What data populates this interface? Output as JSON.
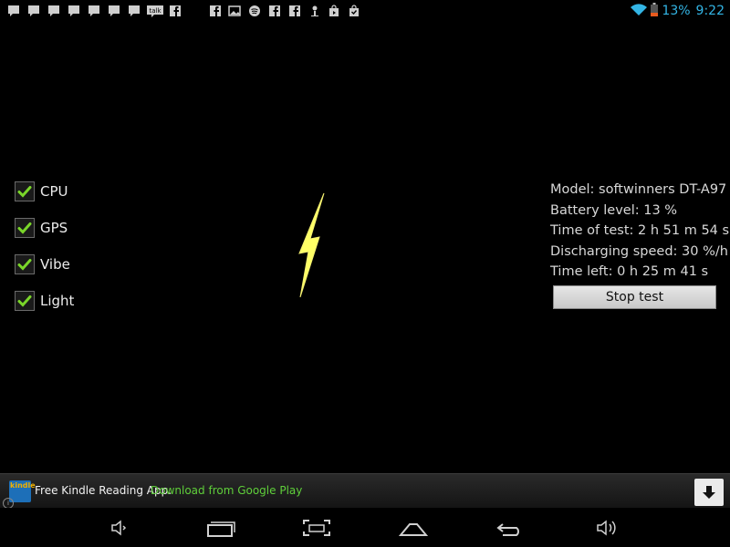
{
  "status_bar": {
    "notification_icons": [
      "message-icon",
      "message-icon",
      "message-icon",
      "message-icon",
      "message-icon",
      "message-icon",
      "message-icon",
      "talk-icon",
      "facebook-icon",
      "facebook-icon",
      "gallery-icon",
      "spotify-icon",
      "facebook-icon",
      "facebook-icon",
      "person-icon",
      "store-icon",
      "shopping-bag-icon"
    ],
    "talk_label": "talk",
    "battery_percent": "13%",
    "time": "9:22",
    "accent_color": "#33b5e5"
  },
  "checklist": {
    "items": [
      {
        "label": "CPU",
        "checked": true
      },
      {
        "label": "GPS",
        "checked": true
      },
      {
        "label": "Vibe",
        "checked": true
      },
      {
        "label": "Light",
        "checked": true
      }
    ],
    "check_color": "#7ad62a"
  },
  "bolt": {
    "icon": "lightning-bolt-icon",
    "color": "#ffff66"
  },
  "info": {
    "model": "Model: softwinners DT-A97",
    "battery_level": "Battery level: 13 %",
    "time_of_test": "Time of test: 2 h 51 m 54 s",
    "discharging_speed": "Discharging speed: 30 %/h",
    "time_left": "Time left: 0 h 25 m 41 s"
  },
  "stop_button": {
    "label": "Stop test"
  },
  "ad": {
    "logo_text": "kindle",
    "title": "Free Kindle Reading App.",
    "link": "Download from Google Play",
    "info_glyph": "i"
  },
  "navbar": {
    "icons": [
      "volume-down-icon",
      "recent-apps-icon",
      "screenshot-icon",
      "home-icon",
      "back-icon",
      "volume-up-icon"
    ]
  }
}
